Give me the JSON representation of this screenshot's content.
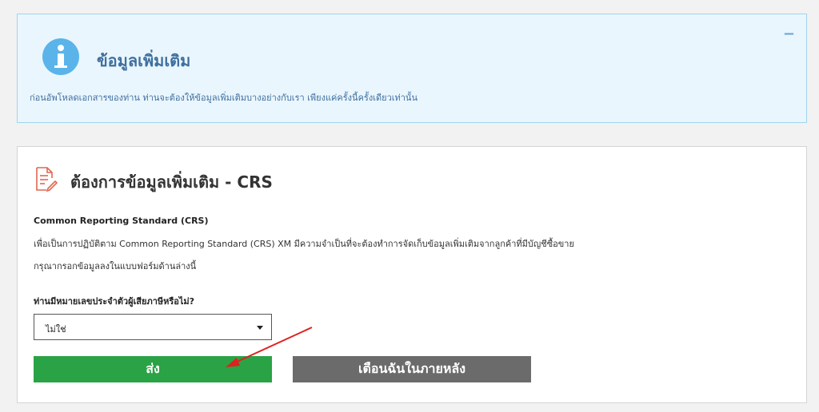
{
  "info": {
    "title": "ข้อมูลเพิ่มเติม",
    "description": "ก่อนอัพโหลดเอกสารของท่าน ท่านจะต้องให้ข้อมูลเพิ่มเติมบางอย่างกับเรา เพียงแค่ครั้งนี้ครั้งเดียวเท่านั้น",
    "collapse_symbol": "−",
    "icon": "info-icon",
    "accent": "#5ab4ea"
  },
  "crs": {
    "title": "ต้องการข้อมูลเพิ่มเติม - CRS",
    "icon": "document-edit-icon",
    "heading": "Common Reporting Standard (CRS)",
    "description": "เพื่อเป็นการปฏิบัติตาม Common Reporting Standard (CRS) XM มีความจำเป็นที่จะต้องทำการจัดเก็บข้อมูลเพิ่มเติมจากลูกค้าที่มีบัญชีซื้อขาย",
    "instruction": "กรุณากรอกข้อมูลลงในแบบฟอร์มด้านล่างนี้",
    "question": "ท่านมีหมายเลขประจำตัวผู้เสียภาษีหรือไม่?",
    "selected_option": "ไม่ใช่",
    "submit_label": "ส่ง",
    "later_label": "เตือนฉันในภายหลัง",
    "submit_color": "#2aa246",
    "later_color": "#6b6b6b"
  }
}
